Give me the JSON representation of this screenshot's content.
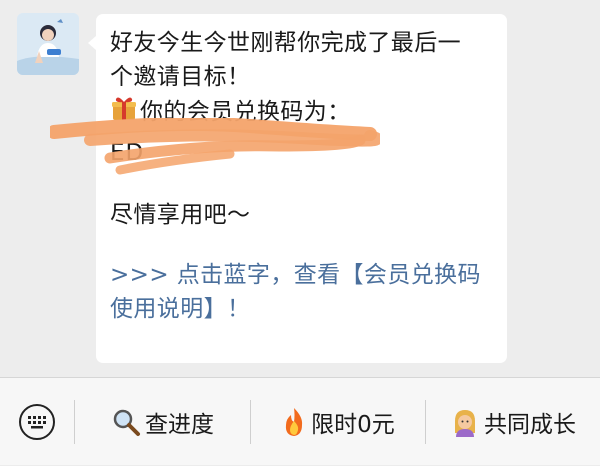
{
  "chat": {
    "message": {
      "line1": "好友今生今世刚帮你完成了最后一",
      "line2": "个邀请目标！",
      "line3": "你的会员兑换码为：",
      "code_visible": "ED",
      "line5": "尽情享用吧～",
      "link_line1": ">>> 点击蓝字，查看【会员兑换码",
      "link_line2": "使用说明】！"
    },
    "avatar_icon": "user-avatar",
    "gift_icon": "gift-icon"
  },
  "menu": {
    "keyboard_icon": "keyboard-icon",
    "items": [
      {
        "label": "查进度",
        "icon": "magnifier-icon"
      },
      {
        "label": "限时0元",
        "icon": "fire-icon"
      },
      {
        "label": "共同成长",
        "icon": "person-icon"
      }
    ]
  },
  "colors": {
    "link": "#4a6f9c",
    "scribble": "#f4a36a",
    "bubble": "#ffffff",
    "background": "#ededed"
  }
}
